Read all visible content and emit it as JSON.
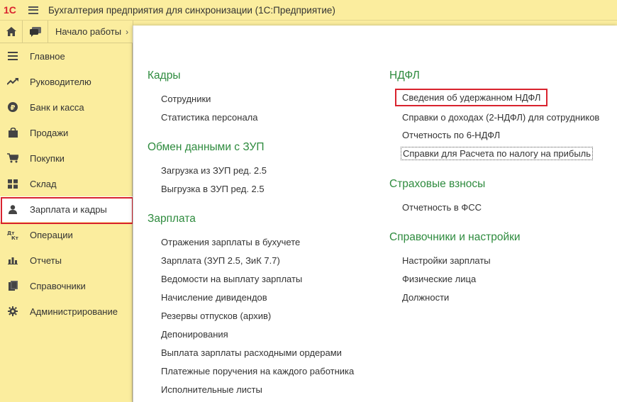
{
  "app": {
    "title": "Бухгалтерия предприятия для синхронизации  (1С:Предприятие)",
    "logo_text": "1С",
    "logo_icon": "1c-logo-icon",
    "menu_icon": "hamburger-icon"
  },
  "tabs": {
    "home_icon": "home-icon",
    "chat_icon": "chat-icon",
    "start_label": "Начало работы",
    "start_chevron": "›"
  },
  "sidebar": {
    "items": [
      {
        "label": "Главное",
        "icon": "list-icon"
      },
      {
        "label": "Руководителю",
        "icon": "trend-icon"
      },
      {
        "label": "Банк и касса",
        "icon": "ruble-icon"
      },
      {
        "label": "Продажи",
        "icon": "bag-icon"
      },
      {
        "label": "Покупки",
        "icon": "cart-icon"
      },
      {
        "label": "Склад",
        "icon": "grid-icon"
      },
      {
        "label": "Зарплата и кадры",
        "icon": "person-icon"
      },
      {
        "label": "Операции",
        "icon": "dt-kt-icon"
      },
      {
        "label": "Отчеты",
        "icon": "bar-chart-icon"
      },
      {
        "label": "Справочники",
        "icon": "books-icon"
      },
      {
        "label": "Администрирование",
        "icon": "gear-icon"
      }
    ],
    "active_index": 6
  },
  "panel": {
    "left": {
      "groups": [
        {
          "title": "Кадры",
          "links": [
            "Сотрудники",
            "Статистика персонала"
          ]
        },
        {
          "title": "Обмен данными с ЗУП",
          "links": [
            "Загрузка из ЗУП ред. 2.5",
            "Выгрузка в ЗУП ред. 2.5"
          ]
        },
        {
          "title": "Зарплата",
          "links": [
            "Отражения зарплаты в бухучете",
            "Зарплата (ЗУП 2.5, ЗиК 7.7)",
            "Ведомости на выплату зарплаты",
            "Начисление дивидендов",
            "Резервы отпусков (архив)",
            "Депонирования",
            "Выплата зарплаты расходными ордерами",
            "Платежные поручения на каждого работника",
            "Исполнительные листы"
          ]
        }
      ]
    },
    "right": {
      "groups": [
        {
          "title": "НДФЛ",
          "links": [
            "Сведения об удержанном НДФЛ",
            "Справки о доходах (2-НДФЛ) для сотрудников",
            "Отчетность по 6-НДФЛ",
            "Справки для Расчета по налогу на прибыль"
          ]
        },
        {
          "title": "Страховые взносы",
          "links": [
            "Отчетность в ФСС"
          ]
        },
        {
          "title": "Справочники и настройки",
          "links": [
            "Настройки зарплаты",
            "Физические лица",
            "Должности"
          ]
        }
      ]
    }
  },
  "colors": {
    "accent_bg": "#fbed9e",
    "group_title": "#2e8b3e",
    "highlight_border": "#d9232e"
  }
}
